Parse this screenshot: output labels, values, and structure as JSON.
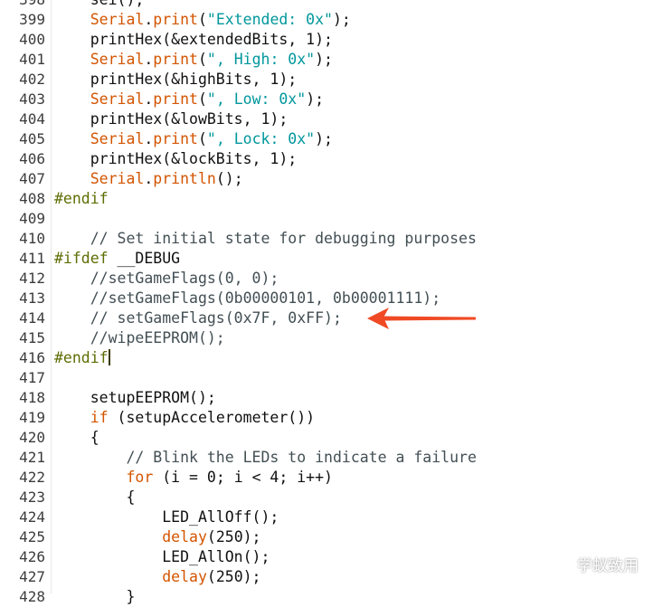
{
  "editor": {
    "lines": [
      {
        "no": "398",
        "segs": [
          {
            "c": "",
            "t": "    sei();"
          }
        ]
      },
      {
        "no": "399",
        "segs": [
          {
            "c": "",
            "t": "    "
          },
          {
            "c": "kw",
            "t": "Serial"
          },
          {
            "c": "",
            "t": "."
          },
          {
            "c": "kw",
            "t": "print"
          },
          {
            "c": "",
            "t": "("
          },
          {
            "c": "str",
            "t": "\"Extended: 0x\""
          },
          {
            "c": "",
            "t": ");"
          }
        ]
      },
      {
        "no": "400",
        "segs": [
          {
            "c": "",
            "t": "    printHex(&extendedBits, 1);"
          }
        ]
      },
      {
        "no": "401",
        "segs": [
          {
            "c": "",
            "t": "    "
          },
          {
            "c": "kw",
            "t": "Serial"
          },
          {
            "c": "",
            "t": "."
          },
          {
            "c": "kw",
            "t": "print"
          },
          {
            "c": "",
            "t": "("
          },
          {
            "c": "str",
            "t": "\", High: 0x\""
          },
          {
            "c": "",
            "t": ");"
          }
        ]
      },
      {
        "no": "402",
        "segs": [
          {
            "c": "",
            "t": "    printHex(&highBits, 1);"
          }
        ]
      },
      {
        "no": "403",
        "segs": [
          {
            "c": "",
            "t": "    "
          },
          {
            "c": "kw",
            "t": "Serial"
          },
          {
            "c": "",
            "t": "."
          },
          {
            "c": "kw",
            "t": "print"
          },
          {
            "c": "",
            "t": "("
          },
          {
            "c": "str",
            "t": "\", Low: 0x\""
          },
          {
            "c": "",
            "t": ");"
          }
        ]
      },
      {
        "no": "404",
        "segs": [
          {
            "c": "",
            "t": "    printHex(&lowBits, 1);"
          }
        ]
      },
      {
        "no": "405",
        "segs": [
          {
            "c": "",
            "t": "    "
          },
          {
            "c": "kw",
            "t": "Serial"
          },
          {
            "c": "",
            "t": "."
          },
          {
            "c": "kw",
            "t": "print"
          },
          {
            "c": "",
            "t": "("
          },
          {
            "c": "str",
            "t": "\", Lock: 0x\""
          },
          {
            "c": "",
            "t": ");"
          }
        ]
      },
      {
        "no": "406",
        "segs": [
          {
            "c": "",
            "t": "    printHex(&lockBits, 1);"
          }
        ]
      },
      {
        "no": "407",
        "segs": [
          {
            "c": "",
            "t": "    "
          },
          {
            "c": "kw",
            "t": "Serial"
          },
          {
            "c": "",
            "t": "."
          },
          {
            "c": "kw",
            "t": "println"
          },
          {
            "c": "",
            "t": "();"
          }
        ]
      },
      {
        "no": "408",
        "segs": [
          {
            "c": "pp",
            "t": "#endif"
          }
        ]
      },
      {
        "no": "409",
        "segs": []
      },
      {
        "no": "410",
        "segs": [
          {
            "c": "cm",
            "t": "    // Set initial state for debugging purposes"
          }
        ]
      },
      {
        "no": "411",
        "segs": [
          {
            "c": "pp",
            "t": "#ifdef"
          },
          {
            "c": "",
            "t": " __DEBUG"
          }
        ]
      },
      {
        "no": "412",
        "segs": [
          {
            "c": "cm",
            "t": "    //setGameFlags(0, 0);"
          }
        ]
      },
      {
        "no": "413",
        "segs": [
          {
            "c": "cm",
            "t": "    //setGameFlags(0b00000101, 0b00001111);"
          }
        ]
      },
      {
        "no": "414",
        "segs": [
          {
            "c": "cm",
            "t": "    // setGameFlags(0x7F, 0xFF);"
          }
        ]
      },
      {
        "no": "415",
        "segs": [
          {
            "c": "cm",
            "t": "    //wipeEEPROM();"
          }
        ]
      },
      {
        "no": "416",
        "segs": [
          {
            "c": "pp",
            "t": "#endif"
          }
        ],
        "caret": true
      },
      {
        "no": "417",
        "segs": []
      },
      {
        "no": "418",
        "segs": [
          {
            "c": "",
            "t": "    setupEEPROM();"
          }
        ]
      },
      {
        "no": "419",
        "segs": [
          {
            "c": "",
            "t": "    "
          },
          {
            "c": "kw",
            "t": "if"
          },
          {
            "c": "",
            "t": " (setupAccelerometer())"
          }
        ]
      },
      {
        "no": "420",
        "segs": [
          {
            "c": "",
            "t": "    {"
          }
        ]
      },
      {
        "no": "421",
        "segs": [
          {
            "c": "cm",
            "t": "        // Blink the LEDs to indicate a failure"
          }
        ]
      },
      {
        "no": "422",
        "segs": [
          {
            "c": "",
            "t": "        "
          },
          {
            "c": "kw",
            "t": "for"
          },
          {
            "c": "",
            "t": " (i = 0; i < 4; i++)"
          }
        ]
      },
      {
        "no": "423",
        "segs": [
          {
            "c": "",
            "t": "        {"
          }
        ]
      },
      {
        "no": "424",
        "segs": [
          {
            "c": "",
            "t": "            LED_AllOff();"
          }
        ]
      },
      {
        "no": "425",
        "segs": [
          {
            "c": "",
            "t": "            "
          },
          {
            "c": "kw",
            "t": "delay"
          },
          {
            "c": "",
            "t": "(250);"
          }
        ]
      },
      {
        "no": "426",
        "segs": [
          {
            "c": "",
            "t": "            LED_AllOn();"
          }
        ]
      },
      {
        "no": "427",
        "segs": [
          {
            "c": "",
            "t": "            "
          },
          {
            "c": "kw",
            "t": "delay"
          },
          {
            "c": "",
            "t": "(250);"
          }
        ]
      },
      {
        "no": "428",
        "segs": [
          {
            "c": "",
            "t": "        }"
          }
        ]
      }
    ]
  },
  "colors": {
    "keyword": "#d35400",
    "string": "#00979c",
    "comment": "#434f54",
    "preprocessor": "#5e6d03",
    "arrow": "#f04a25"
  },
  "annotation": {
    "icon": "arrow-left-icon"
  },
  "watermark": {
    "icon": "wechat-icon",
    "text": "学蚁致用"
  }
}
